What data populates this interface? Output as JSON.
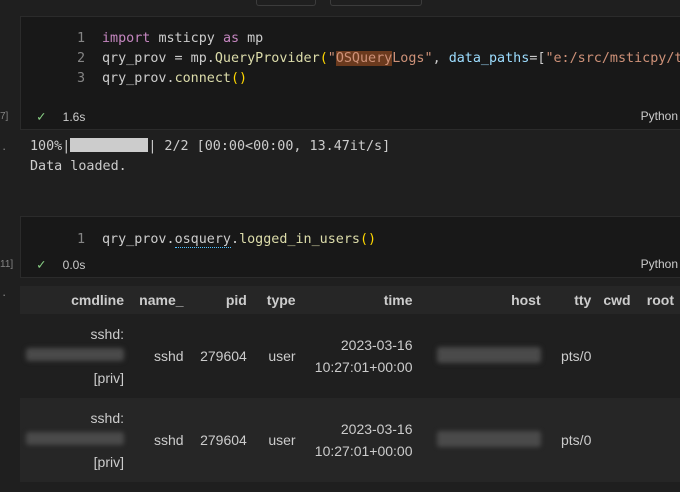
{
  "cell1": {
    "lines": [
      {
        "num": "1",
        "kw1": "import",
        "mod": "msticpy",
        "kw2": "as",
        "alias": "mp"
      },
      {
        "num": "2",
        "pre": "qry_prov = mp.",
        "fn": "QueryProvider",
        "open": "(",
        "q1": "\"",
        "str_hl": "OSQuery",
        "str_rest": "Logs\"",
        "comma": ", ",
        "param": "data_paths",
        "eq": "=[",
        "path": "\"e:/src/msticpy/test"
      },
      {
        "num": "3",
        "pre": "qry_prov.",
        "fn": "connect",
        "parens": "()"
      }
    ],
    "gutter": "7]",
    "status_check": "✓",
    "time": "1.6s",
    "language": "Python"
  },
  "output1": {
    "gutter": "·",
    "progress_pct": "100%|",
    "progress_fraction": 1.0,
    "progress_rest": "| 2/2 [00:00<00:00, 13.47it/s]",
    "loaded": "Data loaded."
  },
  "cell2": {
    "line": {
      "num": "1",
      "pre": "qry_prov.",
      "sq": "osquery",
      "mid": ".",
      "fn": "logged_in_users",
      "parens": "()"
    },
    "gutter": "11]",
    "status_check": "✓",
    "time": "0.0s",
    "language": "Python"
  },
  "output2": {
    "gutter": "·",
    "columns": [
      "cmdline",
      "name_",
      "pid",
      "type",
      "time",
      "host",
      "tty",
      "cwd",
      "root"
    ],
    "rows": [
      {
        "cmd_top": "sshd:",
        "cmd_bottom": "[priv]",
        "name": "sshd",
        "pid": "279604",
        "type": "user",
        "time_date": "2023-03-16",
        "time_clock": "10:27:01+00:00",
        "tty": "pts/0"
      },
      {
        "cmd_top": "sshd:",
        "cmd_bottom": "[priv]",
        "name": "sshd",
        "pid": "279604",
        "type": "user",
        "time_date": "2023-03-16",
        "time_clock": "10:27:01+00:00",
        "tty": "pts/0"
      }
    ]
  }
}
